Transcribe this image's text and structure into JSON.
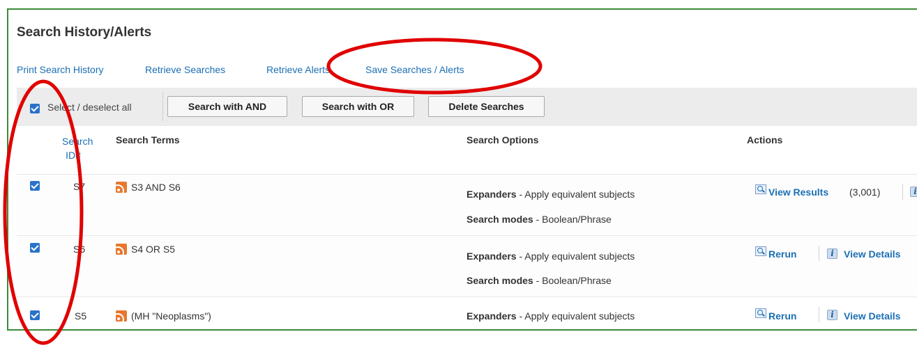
{
  "title": "Search History/Alerts",
  "links": [
    "Print Search History",
    "Retrieve Searches",
    "Retrieve Alerts",
    "Save Searches / Alerts"
  ],
  "toolbar": {
    "select_all_label": "Select / deselect all",
    "select_all_checked": true,
    "and_button": "Search with AND",
    "or_button": "Search with OR",
    "delete_button": "Delete Searches"
  },
  "columns": {
    "search_id_line1": "Search",
    "search_id_line2": "ID#",
    "terms": "Search Terms",
    "options": "Search Options",
    "actions": "Actions"
  },
  "rows": [
    {
      "checked": true,
      "id": "S7",
      "terms": "S3 AND S6",
      "expanders_label": "Expanders",
      "expanders_value": " - Apply equivalent subjects",
      "modes_label": "Search modes",
      "modes_value": " - Boolean/Phrase",
      "action": "View Results",
      "count": "(3,001)"
    },
    {
      "checked": true,
      "id": "S6",
      "terms": "S4 OR S5",
      "expanders_label": "Expanders",
      "expanders_value": " - Apply equivalent subjects",
      "modes_label": "Search modes",
      "modes_value": " - Boolean/Phrase",
      "action": "Rerun",
      "details": "View Details"
    },
    {
      "checked": true,
      "id": "S5",
      "terms": "(MH \"Neoplasms\")",
      "expanders_label": "Expanders",
      "expanders_value": " - Apply equivalent subjects",
      "action": "Rerun",
      "details": "View Details"
    }
  ],
  "colors": {
    "link": "#1a6fb4",
    "frame": "#3b8a3b",
    "annotation": "#e00000",
    "checkbox": "#2a72c9",
    "rss": "#e8772e"
  }
}
